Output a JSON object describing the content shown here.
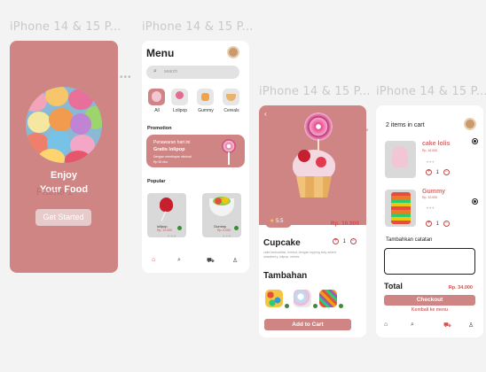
{
  "frame_labels": [
    "iPhone 14 & 15 P...",
    "iPhone 14 & 15 P...",
    "iPhone 14 & 15 P...",
    "iPhone 14 & 15 P..."
  ],
  "colors": {
    "brand": "#d08585",
    "price": "#d05050",
    "add": "#3a8c3a"
  },
  "splash": {
    "line1": "Enjoy",
    "line2": "Your Food",
    "ghost_label": "Frame 1",
    "cta": "Get Started"
  },
  "menu": {
    "title": "Menu",
    "search_placeholder": "search",
    "categories": [
      {
        "label": "All"
      },
      {
        "label": "Lolipop"
      },
      {
        "label": "Gummy"
      },
      {
        "label": "Cereals"
      }
    ],
    "promotion_title": "Promotion",
    "promo": {
      "line1": "Penawaran hari ini",
      "line2": "Gratis lolipop",
      "line3": "Dengan membayar minimal",
      "line4": "Rp 50 ribu"
    },
    "popular_title": "Popular",
    "products": [
      {
        "name": "lolipop",
        "price": "Rp. 10.000"
      },
      {
        "name": "Gummy",
        "price": "Rp. 5.000"
      }
    ],
    "nav_icons": [
      "home-icon",
      "search-icon",
      "cart-icon",
      "profile-icon"
    ]
  },
  "detail": {
    "rating": "5.5",
    "price": "Rp. 16.900",
    "name": "Cupcake",
    "description": "cake berkualitas, lembut, dengan topping stay added strawberry, lolipop, meses",
    "qty": "1",
    "extras_title": "Tambahan",
    "add_to_cart": "Add to Cart"
  },
  "cart": {
    "count_text": "2 items in cart",
    "items": [
      {
        "name": "cake lolis",
        "price": "Rp. 16.000",
        "qty": "1"
      },
      {
        "name": "Gummy",
        "price": "Rp. 10.000",
        "qty": "1"
      }
    ],
    "note_label": "Tambahkan catatan",
    "total_label": "Total",
    "total_value": "Rp. 34.000",
    "checkout": "Checkout",
    "back": "Kembali ke menu"
  }
}
